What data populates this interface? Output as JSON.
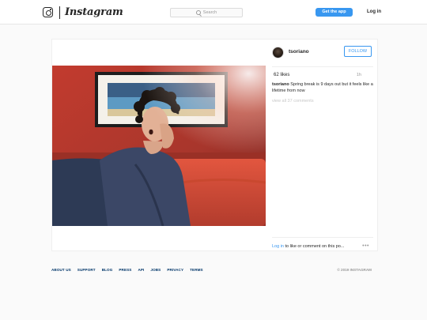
{
  "header": {
    "brand_name": "Instagram",
    "search_placeholder": "Search",
    "get_app_label": "Get the app",
    "login_label": "Log in"
  },
  "post": {
    "author": {
      "username": "tsoriano",
      "follow_label": "FOLLOW"
    },
    "likes": "62 likes",
    "age": "1h",
    "caption": {
      "username": "tsoriano",
      "text": "Spring break is 9 days out but it feels like a lifetime from now"
    },
    "view_all_comments": "view all 37 comments",
    "comment_prompt": {
      "login_link": "Log in",
      "rest": " to like or comment on this po..."
    },
    "more_options": "•••"
  },
  "footer": {
    "links": [
      "ABOUT US",
      "SUPPORT",
      "BLOG",
      "PRESS",
      "API",
      "JOBS",
      "PRIVACY",
      "TERMS"
    ],
    "copyright": "© 2019 INSTAGRAM"
  },
  "colors": {
    "accent": "#3897f0",
    "link_dark": "#003569",
    "page_bg": "#fafafa",
    "text": "#262626",
    "muted": "#999999"
  }
}
